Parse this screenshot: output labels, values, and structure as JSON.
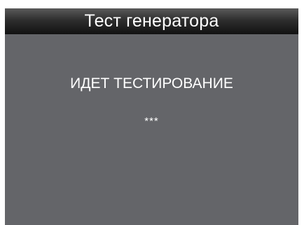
{
  "window": {
    "title": "Тест генератора"
  },
  "main": {
    "status": "ИДЕТ ТЕСТИРОВАНИЕ",
    "progress_indicator": "***"
  },
  "colors": {
    "screen_background": "#646569",
    "title_bar_top": "#5a5a5a",
    "title_bar_bottom": "#121212",
    "text": "#ffffff"
  }
}
